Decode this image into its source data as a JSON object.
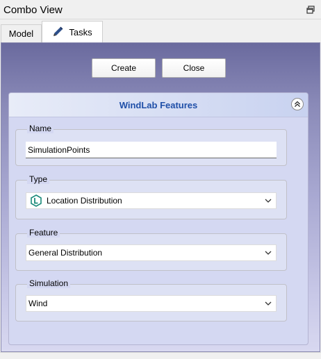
{
  "window": {
    "title": "Combo View"
  },
  "tabs": [
    {
      "label": "Model"
    },
    {
      "label": "Tasks"
    }
  ],
  "actions": {
    "create_label": "Create",
    "close_label": "Close"
  },
  "panel": {
    "title": "WindLab Features",
    "fields": {
      "name": {
        "label": "Name",
        "value": "SimulationPoints"
      },
      "type": {
        "label": "Type",
        "value": "Location Distribution",
        "icon": "location-distribution-icon"
      },
      "feature": {
        "label": "Feature",
        "value": "General Distribution"
      },
      "simulation": {
        "label": "Simulation",
        "value": "Wind"
      }
    }
  },
  "colors": {
    "panel_title": "#1f4fa8",
    "panel_gradient_top": "#6a6a9e",
    "panel_gradient_bottom": "#d8d8f0",
    "icon_teal": "#1a8a7a"
  }
}
